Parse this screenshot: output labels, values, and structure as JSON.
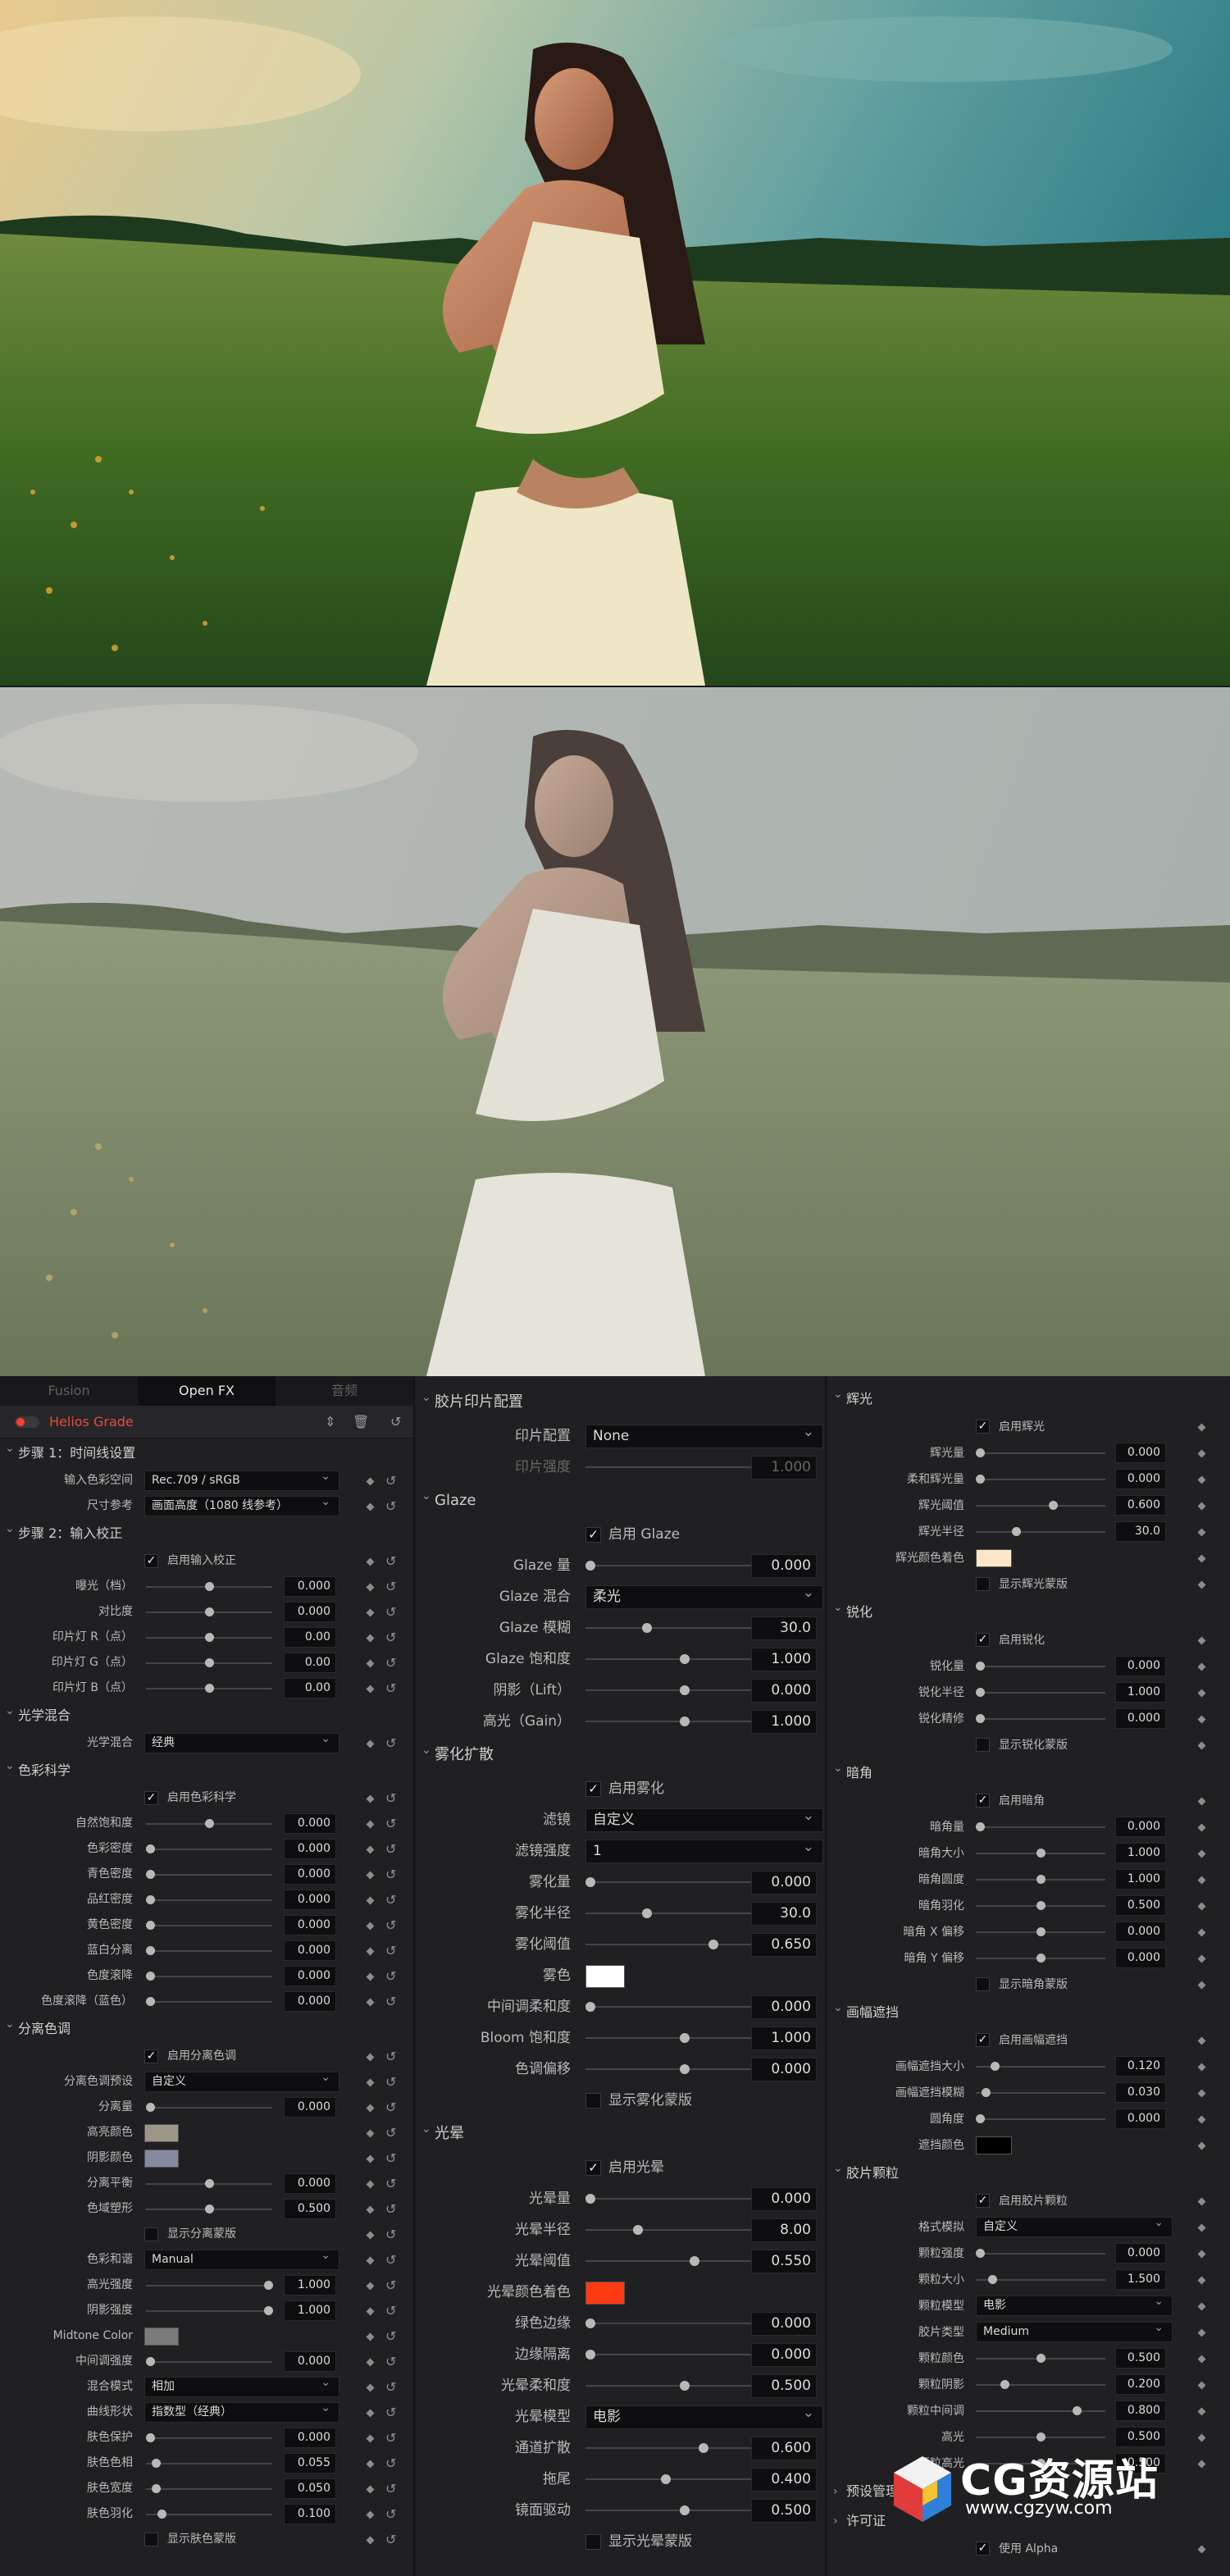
{
  "tabs": [
    "Fusion",
    "Open FX",
    "音频"
  ],
  "plugin_title": "Helios Grade",
  "col1": [
    {
      "type": "section",
      "label": "步骤 1：时间线设置"
    },
    {
      "type": "select",
      "label": "输入色彩空间",
      "value": "Rec.709 / sRGB"
    },
    {
      "type": "select",
      "label": "尺寸参考",
      "value": "画面高度（1080 线参考）"
    },
    {
      "type": "section",
      "label": "步骤 2：输入校正"
    },
    {
      "type": "check",
      "label": "启用输入校正",
      "checked": true
    },
    {
      "type": "slider",
      "label": "曝光（档）",
      "value": "0.000",
      "pos": 0.5
    },
    {
      "type": "slider",
      "label": "对比度",
      "value": "0.000",
      "pos": 0.5
    },
    {
      "type": "slider",
      "label": "印片灯 R（点）",
      "value": "0.00",
      "pos": 0.5
    },
    {
      "type": "slider",
      "label": "印片灯 G（点）",
      "value": "0.00",
      "pos": 0.5
    },
    {
      "type": "slider",
      "label": "印片灯 B（点）",
      "value": "0.00",
      "pos": 0.5
    },
    {
      "type": "section",
      "label": "光学混合"
    },
    {
      "type": "select",
      "label": "光学混合",
      "value": "经典"
    },
    {
      "type": "section",
      "label": "色彩科学"
    },
    {
      "type": "check",
      "label": "启用色彩科学",
      "checked": true
    },
    {
      "type": "slider",
      "label": "自然饱和度",
      "value": "0.000",
      "pos": 0.5
    },
    {
      "type": "slider",
      "label": "色彩密度",
      "value": "0.000",
      "pos": 0.0
    },
    {
      "type": "slider",
      "label": "青色密度",
      "value": "0.000",
      "pos": 0.0
    },
    {
      "type": "slider",
      "label": "品红密度",
      "value": "0.000",
      "pos": 0.0
    },
    {
      "type": "slider",
      "label": "黄色密度",
      "value": "0.000",
      "pos": 0.0
    },
    {
      "type": "slider",
      "label": "蓝白分离",
      "value": "0.000",
      "pos": 0.0
    },
    {
      "type": "slider",
      "label": "色度滚降",
      "value": "0.000",
      "pos": 0.0
    },
    {
      "type": "slider",
      "label": "色度滚降（蓝色）",
      "value": "0.000",
      "pos": 0.0
    },
    {
      "type": "section",
      "label": "分离色调"
    },
    {
      "type": "check",
      "label": "启用分离色调",
      "checked": true
    },
    {
      "type": "select",
      "label": "分离色调预设",
      "value": "自定义"
    },
    {
      "type": "slider",
      "label": "分离量",
      "value": "0.000",
      "pos": 0.0
    },
    {
      "type": "swatch",
      "label": "高亮颜色",
      "color": "#9c9688"
    },
    {
      "type": "swatch",
      "label": "阴影颜色",
      "color": "#868aa0"
    },
    {
      "type": "slider",
      "label": "分离平衡",
      "value": "0.000",
      "pos": 0.5
    },
    {
      "type": "slider",
      "label": "色域塑形",
      "value": "0.500",
      "pos": 0.5
    },
    {
      "type": "check",
      "label": "显示分离蒙版",
      "checked": false
    },
    {
      "type": "select",
      "label": "色彩和谐",
      "value": "Manual"
    },
    {
      "type": "slider",
      "label": "高光强度",
      "value": "1.000",
      "pos": 1.0
    },
    {
      "type": "slider",
      "label": "阴影强度",
      "value": "1.000",
      "pos": 1.0
    },
    {
      "type": "swatch",
      "label": "Midtone Color",
      "color": "#7a7a7a"
    },
    {
      "type": "slider",
      "label": "中间调强度",
      "value": "0.000",
      "pos": 0.0
    },
    {
      "type": "select",
      "label": "混合模式",
      "value": "相加"
    },
    {
      "type": "select",
      "label": "曲线形状",
      "value": "指数型（经典）"
    },
    {
      "type": "slider",
      "label": "肤色保护",
      "value": "0.000",
      "pos": 0.0
    },
    {
      "type": "slider",
      "label": "肤色色相",
      "value": "0.055",
      "pos": 0.05
    },
    {
      "type": "slider",
      "label": "肤色宽度",
      "value": "0.050",
      "pos": 0.05
    },
    {
      "type": "slider",
      "label": "肤色羽化",
      "value": "0.100",
      "pos": 0.1
    },
    {
      "type": "check",
      "label": "显示肤色蒙版",
      "checked": false
    }
  ],
  "col2": [
    {
      "type": "cutoff",
      "label": "显示分离蒙版"
    },
    {
      "type": "section",
      "label": "胶片印片配置"
    },
    {
      "type": "select",
      "label": "印片配置",
      "value": "None"
    },
    {
      "type": "slider",
      "label": "印片强度",
      "value": "1.000",
      "pos": 1.0,
      "dim": true
    },
    {
      "type": "section",
      "label": "Glaze"
    },
    {
      "type": "check",
      "label": "启用 Glaze",
      "checked": true
    },
    {
      "type": "slider",
      "label": "Glaze 量",
      "value": "0.000",
      "pos": 0.0
    },
    {
      "type": "select",
      "label": "Glaze 混合",
      "value": "柔光"
    },
    {
      "type": "slider",
      "label": "Glaze 模糊",
      "value": "30.0",
      "pos": 0.3
    },
    {
      "type": "slider",
      "label": "Glaze 饱和度",
      "value": "1.000",
      "pos": 0.5
    },
    {
      "type": "slider",
      "label": "阴影（Lift）",
      "value": "0.000",
      "pos": 0.5
    },
    {
      "type": "slider",
      "label": "高光（Gain）",
      "value": "1.000",
      "pos": 0.5
    },
    {
      "type": "section",
      "label": "雾化扩散"
    },
    {
      "type": "check",
      "label": "启用雾化",
      "checked": true
    },
    {
      "type": "select",
      "label": "滤镜",
      "value": "自定义"
    },
    {
      "type": "select",
      "label": "滤镜强度",
      "value": "1"
    },
    {
      "type": "slider",
      "label": "雾化量",
      "value": "0.000",
      "pos": 0.0
    },
    {
      "type": "slider",
      "label": "雾化半径",
      "value": "30.0",
      "pos": 0.3
    },
    {
      "type": "slider",
      "label": "雾化阈值",
      "value": "0.650",
      "pos": 0.65
    },
    {
      "type": "swatch",
      "label": "雾色",
      "color": "#ffffff"
    },
    {
      "type": "slider",
      "label": "中间调柔和度",
      "value": "0.000",
      "pos": 0.0
    },
    {
      "type": "slider",
      "label": "Bloom 饱和度",
      "value": "1.000",
      "pos": 0.5
    },
    {
      "type": "slider",
      "label": "色调偏移",
      "value": "0.000",
      "pos": 0.5
    },
    {
      "type": "check",
      "label": "显示雾化蒙版",
      "checked": false
    },
    {
      "type": "section",
      "label": "光晕"
    },
    {
      "type": "check",
      "label": "启用光晕",
      "checked": true
    },
    {
      "type": "slider",
      "label": "光晕量",
      "value": "0.000",
      "pos": 0.0
    },
    {
      "type": "slider",
      "label": "光晕半径",
      "value": "8.00",
      "pos": 0.25
    },
    {
      "type": "slider",
      "label": "光晕阈值",
      "value": "0.550",
      "pos": 0.55
    },
    {
      "type": "swatch",
      "label": "光晕颜色着色",
      "color": "#ff3a12"
    },
    {
      "type": "slider",
      "label": "绿色边缘",
      "value": "0.000",
      "pos": 0.0
    },
    {
      "type": "slider",
      "label": "边缘隔离",
      "value": "0.000",
      "pos": 0.0
    },
    {
      "type": "slider",
      "label": "光晕柔和度",
      "value": "0.500",
      "pos": 0.5
    },
    {
      "type": "select",
      "label": "光晕模型",
      "value": "电影"
    },
    {
      "type": "slider",
      "label": "通道扩散",
      "value": "0.600",
      "pos": 0.6
    },
    {
      "type": "slider",
      "label": "拖尾",
      "value": "0.400",
      "pos": 0.4
    },
    {
      "type": "slider",
      "label": "镜面驱动",
      "value": "0.500",
      "pos": 0.5
    },
    {
      "type": "check",
      "label": "显示光晕蒙版",
      "checked": false
    }
  ],
  "col3": [
    {
      "type": "section",
      "label": "辉光"
    },
    {
      "type": "check",
      "label": "启用辉光",
      "checked": true
    },
    {
      "type": "slider",
      "label": "辉光量",
      "value": "0.000",
      "pos": 0.0
    },
    {
      "type": "slider",
      "label": "柔和辉光量",
      "value": "0.000",
      "pos": 0.0
    },
    {
      "type": "slider",
      "label": "辉光阈值",
      "value": "0.600",
      "pos": 0.6
    },
    {
      "type": "slider",
      "label": "辉光半径",
      "value": "30.0",
      "pos": 0.3
    },
    {
      "type": "swatch",
      "label": "辉光颜色着色",
      "color": "#fbe7c7"
    },
    {
      "type": "check",
      "label": "显示辉光蒙版",
      "checked": false
    },
    {
      "type": "section",
      "label": "锐化"
    },
    {
      "type": "check",
      "label": "启用锐化",
      "checked": true
    },
    {
      "type": "slider",
      "label": "锐化量",
      "value": "0.000",
      "pos": 0.0
    },
    {
      "type": "slider",
      "label": "锐化半径",
      "value": "1.000",
      "pos": 0.0
    },
    {
      "type": "slider",
      "label": "锐化精修",
      "value": "0.000",
      "pos": 0.0
    },
    {
      "type": "check",
      "label": "显示锐化蒙版",
      "checked": false
    },
    {
      "type": "section",
      "label": "暗角"
    },
    {
      "type": "check",
      "label": "启用暗角",
      "checked": true
    },
    {
      "type": "slider",
      "label": "暗角量",
      "value": "0.000",
      "pos": 0.0
    },
    {
      "type": "slider",
      "label": "暗角大小",
      "value": "1.000",
      "pos": 0.5
    },
    {
      "type": "slider",
      "label": "暗角圆度",
      "value": "1.000",
      "pos": 0.5
    },
    {
      "type": "slider",
      "label": "暗角羽化",
      "value": "0.500",
      "pos": 0.5
    },
    {
      "type": "slider",
      "label": "暗角 X 偏移",
      "value": "0.000",
      "pos": 0.5
    },
    {
      "type": "slider",
      "label": "暗角 Y 偏移",
      "value": "0.000",
      "pos": 0.5
    },
    {
      "type": "check",
      "label": "显示暗角蒙版",
      "checked": false
    },
    {
      "type": "section",
      "label": "画幅遮挡"
    },
    {
      "type": "check",
      "label": "启用画幅遮挡",
      "checked": true
    },
    {
      "type": "slider",
      "label": "画幅遮挡大小",
      "value": "0.120",
      "pos": 0.12
    },
    {
      "type": "slider",
      "label": "画幅遮挡模糊",
      "value": "0.030",
      "pos": 0.05
    },
    {
      "type": "slider",
      "label": "圆角度",
      "value": "0.000",
      "pos": 0.0
    },
    {
      "type": "swatch",
      "label": "遮挡颜色",
      "color": "#000000"
    },
    {
      "type": "section",
      "label": "胶片颗粒"
    },
    {
      "type": "check",
      "label": "启用胶片颗粒",
      "checked": true
    },
    {
      "type": "select",
      "label": "格式模拟",
      "value": "自定义"
    },
    {
      "type": "slider",
      "label": "颗粒强度",
      "value": "0.000",
      "pos": 0.0
    },
    {
      "type": "slider",
      "label": "颗粒大小",
      "value": "1.500",
      "pos": 0.1
    },
    {
      "type": "select",
      "label": "颗粒模型",
      "value": "电影"
    },
    {
      "type": "select",
      "label": "胶片类型",
      "value": "Medium"
    },
    {
      "type": "slider",
      "label": "颗粒颜色",
      "value": "0.500",
      "pos": 0.5
    },
    {
      "type": "slider",
      "label": "颗粒阴影",
      "value": "0.200",
      "pos": 0.2
    },
    {
      "type": "slider",
      "label": "颗粒中间调",
      "value": "0.800",
      "pos": 0.8
    },
    {
      "type": "slider",
      "label": "高光",
      "value": "0.500",
      "pos": 0.5
    },
    {
      "type": "slider",
      "label": "颗粒高光",
      "value": "0.500",
      "pos": 0.5
    },
    {
      "type": "section",
      "label": "预设管理",
      "collapsed": true
    },
    {
      "type": "section",
      "label": "许可证",
      "collapsed": true
    },
    {
      "type": "check",
      "label": "使用 Alpha",
      "checked": true
    }
  ],
  "watermark": {
    "name": "CG资源站",
    "url": "www.cgzyw.com"
  },
  "colors": {
    "accent": "#e84a3b",
    "panel": "#202023",
    "field": "#0e0e10"
  }
}
